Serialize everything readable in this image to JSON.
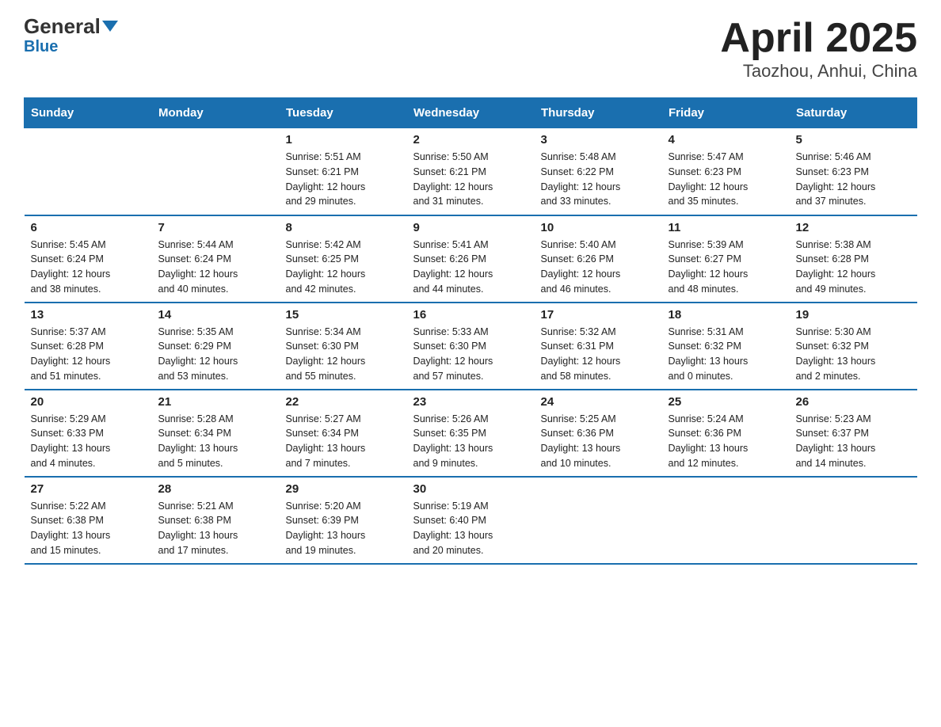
{
  "header": {
    "logo_general": "General",
    "logo_blue": "Blue",
    "title": "April 2025",
    "subtitle": "Taozhou, Anhui, China"
  },
  "weekdays": [
    "Sunday",
    "Monday",
    "Tuesday",
    "Wednesday",
    "Thursday",
    "Friday",
    "Saturday"
  ],
  "weeks": [
    [
      {
        "day": "",
        "info": ""
      },
      {
        "day": "",
        "info": ""
      },
      {
        "day": "1",
        "info": "Sunrise: 5:51 AM\nSunset: 6:21 PM\nDaylight: 12 hours\nand 29 minutes."
      },
      {
        "day": "2",
        "info": "Sunrise: 5:50 AM\nSunset: 6:21 PM\nDaylight: 12 hours\nand 31 minutes."
      },
      {
        "day": "3",
        "info": "Sunrise: 5:48 AM\nSunset: 6:22 PM\nDaylight: 12 hours\nand 33 minutes."
      },
      {
        "day": "4",
        "info": "Sunrise: 5:47 AM\nSunset: 6:23 PM\nDaylight: 12 hours\nand 35 minutes."
      },
      {
        "day": "5",
        "info": "Sunrise: 5:46 AM\nSunset: 6:23 PM\nDaylight: 12 hours\nand 37 minutes."
      }
    ],
    [
      {
        "day": "6",
        "info": "Sunrise: 5:45 AM\nSunset: 6:24 PM\nDaylight: 12 hours\nand 38 minutes."
      },
      {
        "day": "7",
        "info": "Sunrise: 5:44 AM\nSunset: 6:24 PM\nDaylight: 12 hours\nand 40 minutes."
      },
      {
        "day": "8",
        "info": "Sunrise: 5:42 AM\nSunset: 6:25 PM\nDaylight: 12 hours\nand 42 minutes."
      },
      {
        "day": "9",
        "info": "Sunrise: 5:41 AM\nSunset: 6:26 PM\nDaylight: 12 hours\nand 44 minutes."
      },
      {
        "day": "10",
        "info": "Sunrise: 5:40 AM\nSunset: 6:26 PM\nDaylight: 12 hours\nand 46 minutes."
      },
      {
        "day": "11",
        "info": "Sunrise: 5:39 AM\nSunset: 6:27 PM\nDaylight: 12 hours\nand 48 minutes."
      },
      {
        "day": "12",
        "info": "Sunrise: 5:38 AM\nSunset: 6:28 PM\nDaylight: 12 hours\nand 49 minutes."
      }
    ],
    [
      {
        "day": "13",
        "info": "Sunrise: 5:37 AM\nSunset: 6:28 PM\nDaylight: 12 hours\nand 51 minutes."
      },
      {
        "day": "14",
        "info": "Sunrise: 5:35 AM\nSunset: 6:29 PM\nDaylight: 12 hours\nand 53 minutes."
      },
      {
        "day": "15",
        "info": "Sunrise: 5:34 AM\nSunset: 6:30 PM\nDaylight: 12 hours\nand 55 minutes."
      },
      {
        "day": "16",
        "info": "Sunrise: 5:33 AM\nSunset: 6:30 PM\nDaylight: 12 hours\nand 57 minutes."
      },
      {
        "day": "17",
        "info": "Sunrise: 5:32 AM\nSunset: 6:31 PM\nDaylight: 12 hours\nand 58 minutes."
      },
      {
        "day": "18",
        "info": "Sunrise: 5:31 AM\nSunset: 6:32 PM\nDaylight: 13 hours\nand 0 minutes."
      },
      {
        "day": "19",
        "info": "Sunrise: 5:30 AM\nSunset: 6:32 PM\nDaylight: 13 hours\nand 2 minutes."
      }
    ],
    [
      {
        "day": "20",
        "info": "Sunrise: 5:29 AM\nSunset: 6:33 PM\nDaylight: 13 hours\nand 4 minutes."
      },
      {
        "day": "21",
        "info": "Sunrise: 5:28 AM\nSunset: 6:34 PM\nDaylight: 13 hours\nand 5 minutes."
      },
      {
        "day": "22",
        "info": "Sunrise: 5:27 AM\nSunset: 6:34 PM\nDaylight: 13 hours\nand 7 minutes."
      },
      {
        "day": "23",
        "info": "Sunrise: 5:26 AM\nSunset: 6:35 PM\nDaylight: 13 hours\nand 9 minutes."
      },
      {
        "day": "24",
        "info": "Sunrise: 5:25 AM\nSunset: 6:36 PM\nDaylight: 13 hours\nand 10 minutes."
      },
      {
        "day": "25",
        "info": "Sunrise: 5:24 AM\nSunset: 6:36 PM\nDaylight: 13 hours\nand 12 minutes."
      },
      {
        "day": "26",
        "info": "Sunrise: 5:23 AM\nSunset: 6:37 PM\nDaylight: 13 hours\nand 14 minutes."
      }
    ],
    [
      {
        "day": "27",
        "info": "Sunrise: 5:22 AM\nSunset: 6:38 PM\nDaylight: 13 hours\nand 15 minutes."
      },
      {
        "day": "28",
        "info": "Sunrise: 5:21 AM\nSunset: 6:38 PM\nDaylight: 13 hours\nand 17 minutes."
      },
      {
        "day": "29",
        "info": "Sunrise: 5:20 AM\nSunset: 6:39 PM\nDaylight: 13 hours\nand 19 minutes."
      },
      {
        "day": "30",
        "info": "Sunrise: 5:19 AM\nSunset: 6:40 PM\nDaylight: 13 hours\nand 20 minutes."
      },
      {
        "day": "",
        "info": ""
      },
      {
        "day": "",
        "info": ""
      },
      {
        "day": "",
        "info": ""
      }
    ]
  ]
}
